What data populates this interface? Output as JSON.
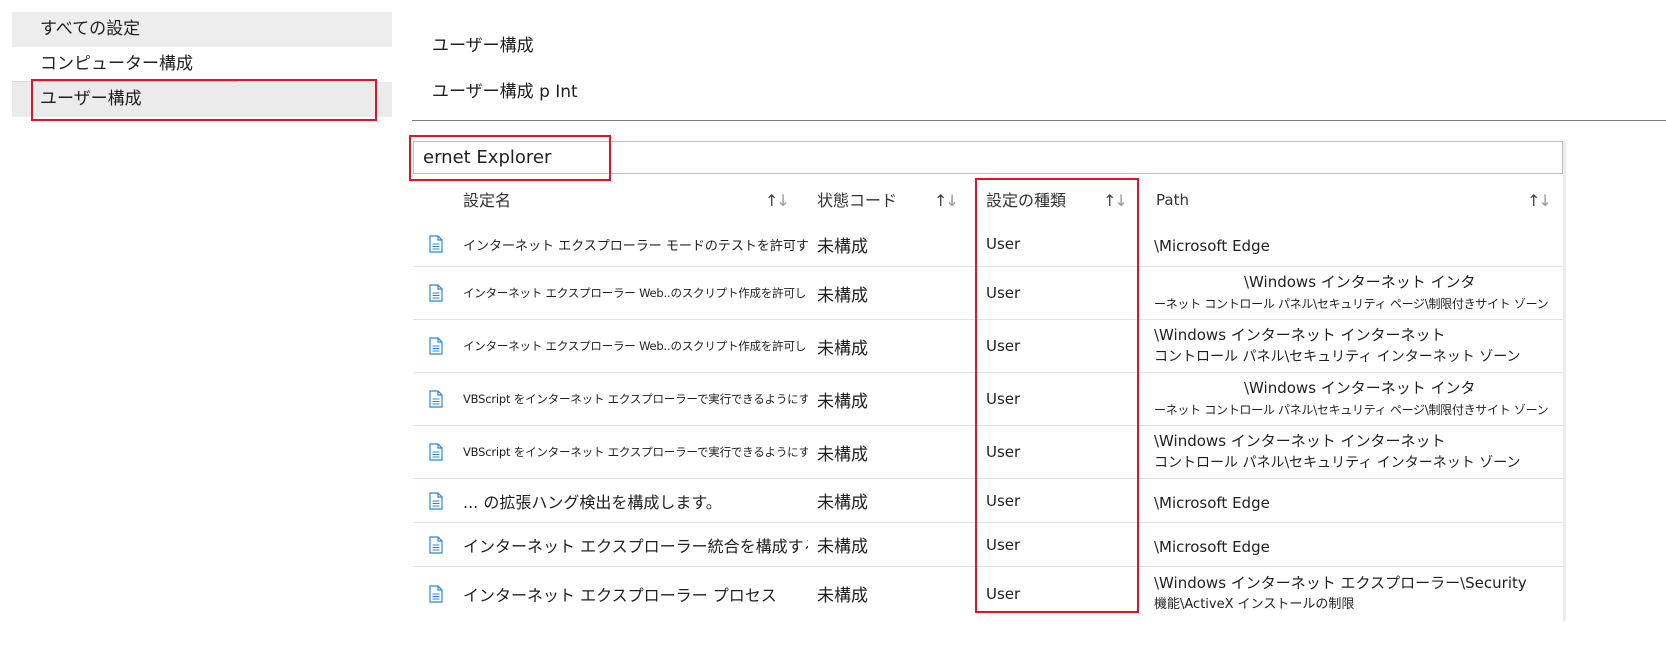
{
  "nav": {
    "items": [
      {
        "label": "すべての設定"
      },
      {
        "label": "コンピューター構成"
      },
      {
        "label": "ユーザー構成"
      }
    ]
  },
  "header": {
    "scope": "ユーザー構成",
    "scope_path": "ユーザー構成 p Int"
  },
  "search": {
    "value": "ernet Explorer"
  },
  "table": {
    "columns": {
      "name": "設定名",
      "state": "状態コード",
      "type": "設定の種類",
      "path": "Path"
    },
    "sort_glyph_up": "↑",
    "sort_glyph_down": "↓",
    "rows": [
      {
        "name": "インターネット エクスプローラー モードのテストを許可する",
        "state": "未構成",
        "type": "User",
        "path": [
          "\\Microsoft Edge"
        ]
      },
      {
        "name": "インターネット エクスプローラー Web..のスクリプト作成を許可します。",
        "state": "未構成",
        "type": "User",
        "path": [
          "\\Windows インターネット インタ",
          "ーネット コントロール パネル\\セキュリティ ページ\\制限付きサイト ゾーン"
        ]
      },
      {
        "name": "インターネット エクスプローラー Web..のスクリプト作成を許可します。",
        "state": "未構成",
        "type": "User",
        "path": [
          "\\Windows インターネット インターネット",
          "コントロール パネル\\セキュリティ インターネット ゾーン"
        ]
      },
      {
        "name": "VBScript をインターネット エクスプローラーで実行できるようにする",
        "state": "未構成",
        "type": "User",
        "path": [
          "\\Windows インターネット インタ",
          "ーネット コントロール パネル\\セキュリティ ページ\\制限付きサイト ゾーン"
        ]
      },
      {
        "name": "VBScript をインターネット エクスプローラーで実行できるようにする",
        "state": "未構成",
        "type": "User",
        "path": [
          "\\Windows インターネット インターネット",
          "コントロール パネル\\セキュリティ インターネット ゾーン"
        ]
      },
      {
        "name": "... の拡張ハング検出を構成します。",
        "state": "未構成",
        "type": "User",
        "path": [
          "\\Microsoft Edge"
        ]
      },
      {
        "name": "インターネット エクスプローラー統合を構成する",
        "state": "未構成",
        "type": "User",
        "path": [
          "\\Microsoft Edge"
        ]
      },
      {
        "name": "インターネット エクスプローラー プロセス",
        "state": "未構成",
        "type": "User",
        "path": [
          "\\Windows インターネット エクスプローラー\\Security",
          "機能\\ActiveX インストールの制限"
        ]
      }
    ]
  },
  "colors": {
    "highlight": "#e81123",
    "doc_icon": "#2b88d8"
  }
}
